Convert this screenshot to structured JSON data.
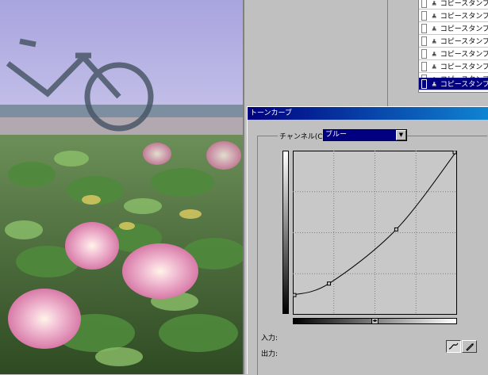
{
  "layers": {
    "items": [
      {
        "name": "コピースタンプ"
      },
      {
        "name": "コピースタンプ"
      },
      {
        "name": "コピースタンプ"
      },
      {
        "name": "コピースタンプ"
      },
      {
        "name": "コピースタンプ"
      },
      {
        "name": "コピースタンプ"
      },
      {
        "name": "コピースタンプ"
      },
      {
        "name": "コピースタンプ",
        "selected": true
      }
    ],
    "layer_icon": "stamp-icon"
  },
  "dialog": {
    "title": "トーンカーブ",
    "channel_label": "チャンネル(C):",
    "channel_value": "ブルー",
    "input_label": "入力:",
    "output_label": "出力:",
    "tools": [
      {
        "icon": "curve-tool-icon",
        "pressed": true
      },
      {
        "icon": "pencil-tool-icon",
        "pressed": false
      }
    ]
  },
  "curve": {
    "control_points": [
      [
        0,
        0.12
      ],
      [
        0.22,
        0.19
      ],
      [
        0.63,
        0.52
      ],
      [
        1,
        1
      ]
    ]
  }
}
